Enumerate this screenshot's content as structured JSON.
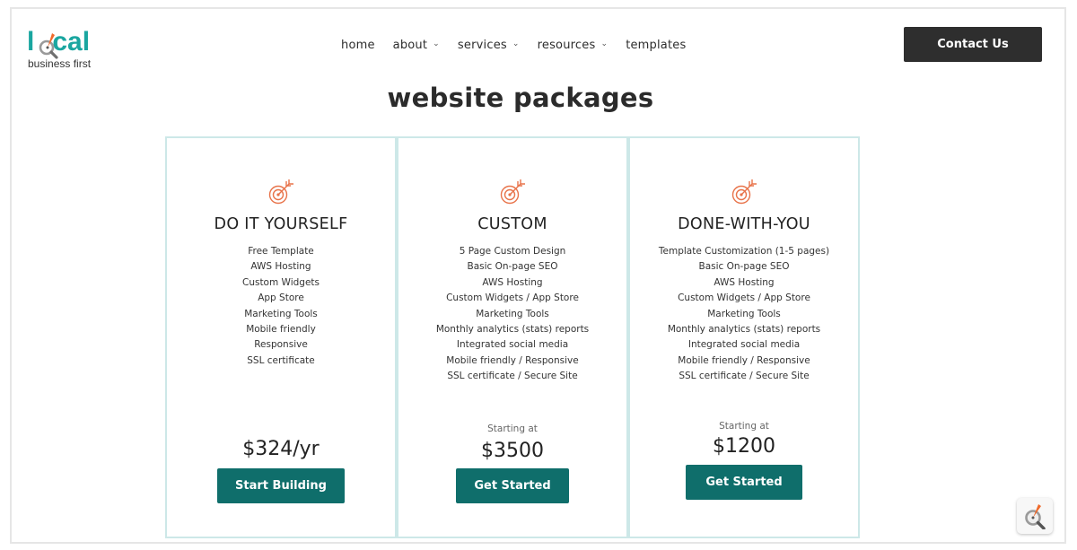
{
  "brand": {
    "logo_word_left": "l",
    "logo_word_right": "cal",
    "logo_sub": "business first",
    "accent_teal": "#1aa6a0",
    "accent_orange": "#f06a2b"
  },
  "nav": {
    "items": [
      {
        "label": "home",
        "has_dropdown": false
      },
      {
        "label": "about",
        "has_dropdown": true
      },
      {
        "label": "services",
        "has_dropdown": true
      },
      {
        "label": "resources",
        "has_dropdown": true
      },
      {
        "label": "templates",
        "has_dropdown": false
      }
    ],
    "dropdown_glyph": "⌄",
    "contact_label": "Contact Us"
  },
  "page": {
    "title": "website packages"
  },
  "packages": [
    {
      "icon": "target-arrow-icon",
      "name": "DO IT YOURSELF",
      "features": [
        "Free Template",
        "AWS Hosting",
        "Custom Widgets",
        "App Store",
        "Marketing Tools",
        "Mobile friendly",
        "Responsive",
        "SSL certificate"
      ],
      "starting_label": "",
      "price": "$324/yr",
      "cta": "Start Building"
    },
    {
      "icon": "target-arrow-icon",
      "name": "CUSTOM",
      "features": [
        "5 Page Custom Design",
        "Basic On-page SEO",
        "AWS Hosting",
        "Custom Widgets / App Store",
        "Marketing Tools",
        "Monthly analytics (stats) reports",
        "Integrated social media",
        "Mobile friendly / Responsive",
        "SSL certificate / Secure Site"
      ],
      "starting_label": "Starting at",
      "price": "$3500",
      "cta": "Get Started"
    },
    {
      "icon": "target-arrow-icon",
      "name": "DONE-WITH-YOU",
      "features": [
        "Template Customization (1-5 pages)",
        "Basic On-page SEO",
        "AWS Hosting",
        "Custom Widgets / App Store",
        "Marketing Tools",
        "Monthly analytics (stats) reports",
        "Integrated social media",
        "Mobile friendly / Responsive",
        "SSL certificate / Secure Site"
      ],
      "starting_label": "Starting at",
      "price": "$1200",
      "cta": "Get Started"
    }
  ],
  "floating_widget": {
    "icon": "magnifier-arrow-icon"
  }
}
